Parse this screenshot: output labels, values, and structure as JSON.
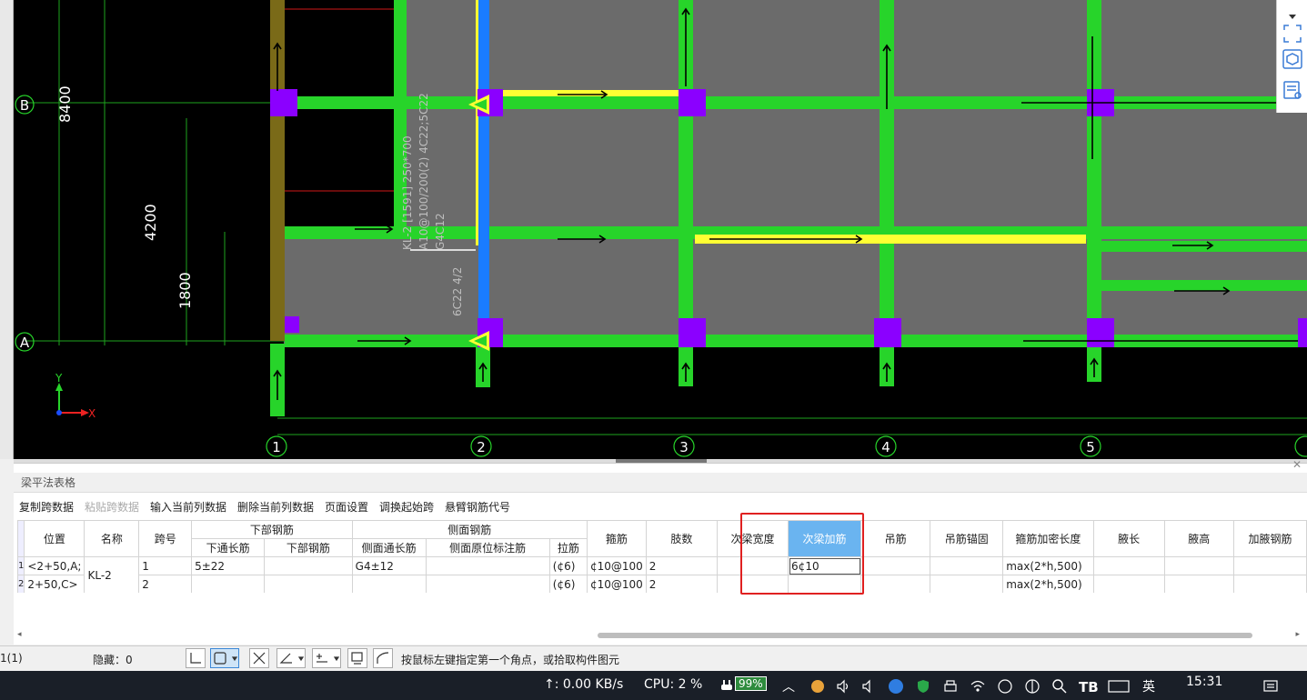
{
  "canvas": {
    "grid_numbers": [
      "1",
      "2",
      "3",
      "4",
      "5"
    ],
    "grid_letters": [
      "B",
      "A"
    ],
    "dimensions": [
      "8400",
      "4200",
      "1800"
    ],
    "beam_annotation": [
      "KL-2 [1591] 250*700",
      "A10@100/200(2) 4C22;5C22",
      "G4C12"
    ],
    "side_annotation": "6C22 4/2",
    "axis_x": "X",
    "axis_y": "Y",
    "colors": {
      "beam": "#27d42a",
      "column": "#8b00ff",
      "slab": "#6b6b6b",
      "highlight": "#ffff33",
      "selected": "#1a7cff",
      "wall": "#7a6a18"
    }
  },
  "panel": {
    "title": "梁平法表格",
    "toolbar": [
      {
        "label": "复制跨数据",
        "enabled": true
      },
      {
        "label": "粘贴跨数据",
        "enabled": false
      },
      {
        "label": "输入当前列数据",
        "enabled": true
      },
      {
        "label": "删除当前列数据",
        "enabled": true
      },
      {
        "label": "页面设置",
        "enabled": true
      },
      {
        "label": "调换起始跨",
        "enabled": true
      },
      {
        "label": "悬臂钢筋代号",
        "enabled": true
      }
    ],
    "headers": {
      "position": "位置",
      "name": "名称",
      "span": "跨号",
      "bottom_group": "下部钢筋",
      "bottom_through": "下通长筋",
      "bottom_bars": "下部钢筋",
      "side_group": "侧面钢筋",
      "side_through": "侧面通长筋",
      "side_in_situ": "侧面原位标注筋",
      "tie": "拉筋",
      "stirrup": "箍筋",
      "legs": "肢数",
      "secondary_width": "次梁宽度",
      "secondary_add": "次梁加筋",
      "hanger": "吊筋",
      "hanger_anchor": "吊筋锚固",
      "dense_length": "箍筋加密长度",
      "haunch_length": "腋长",
      "haunch_height": "腋高",
      "haunch_bars": "加腋钢筋"
    },
    "rows": [
      {
        "row_no": "1",
        "position": "<2+50,A;",
        "name": "KL-2",
        "span": "1",
        "bottom_through": "5±22",
        "bottom_bars": "",
        "side_through": "G4±12",
        "side_in_situ": "",
        "tie": "(¢6)",
        "stirrup": "¢10@100",
        "legs": "2",
        "secondary_width": "",
        "secondary_add": "6¢10",
        "hanger": "",
        "hanger_anchor": "",
        "dense_length": "max(2*h,500)"
      },
      {
        "row_no": "2",
        "position": "2+50,C>",
        "name": "",
        "span": "2",
        "bottom_through": "",
        "bottom_bars": "",
        "side_through": "",
        "side_in_situ": "",
        "tie": "(¢6)",
        "stirrup": "¢10@100",
        "legs": "2",
        "secondary_width": "",
        "secondary_add": "",
        "hanger": "",
        "hanger_anchor": "",
        "dense_length": "max(2*h,500)"
      }
    ]
  },
  "statusbar": {
    "left_text": "1(1)",
    "hidden_label": "隐藏：0",
    "prompt": "按鼠标左键指定第一个角点，或拾取构件图元"
  },
  "taskbar": {
    "network": "↑: 0.00 KB/s",
    "cpu": "CPU: 2 %",
    "battery": "99%",
    "ime": "英",
    "clock": "15:31"
  }
}
